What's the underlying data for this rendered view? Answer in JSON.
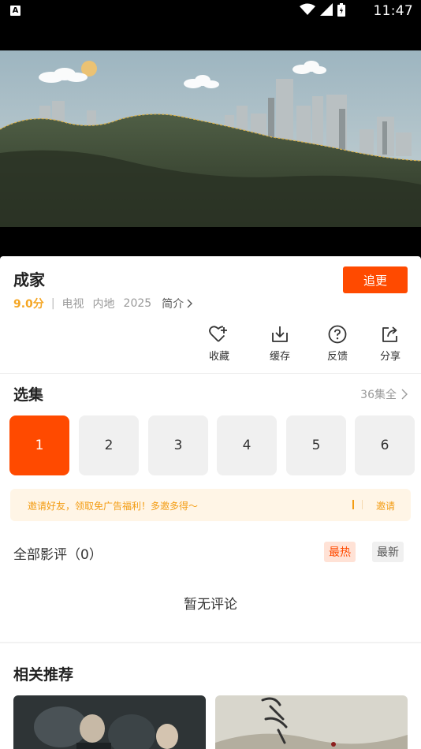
{
  "status_bar": {
    "app_badge": "A",
    "time": "11:47",
    "icons": [
      "wifi-icon",
      "signal-icon",
      "battery-icon"
    ]
  },
  "video": {
    "description_icon": "video-player-frame"
  },
  "drama": {
    "title": "成家",
    "score": "9.0分",
    "type": "电视",
    "region": "内地",
    "year": "2025",
    "intro_label": "简介",
    "follow_label": "追更"
  },
  "actions": [
    {
      "label": "收藏",
      "icon": "heart-plus-icon"
    },
    {
      "label": "缓存",
      "icon": "download-icon"
    },
    {
      "label": "反馈",
      "icon": "question-icon"
    },
    {
      "label": "分享",
      "icon": "share-icon"
    }
  ],
  "episodes": {
    "heading": "选集",
    "count_label": "36集全",
    "items": [
      "1",
      "2",
      "3",
      "4",
      "5",
      "6"
    ],
    "active_index": 0
  },
  "invite": {
    "message": "邀请好友，领取免广告福利！多邀多得～",
    "link_label": "邀请"
  },
  "reviews": {
    "title": "全部影评（0）",
    "sort_hot": "最热",
    "sort_new": "最新",
    "empty_text": "暂无评论"
  },
  "recommendations": {
    "heading": "相关推荐"
  },
  "colors": {
    "accent": "#ff4a00",
    "score": "#f5a623",
    "invite_text": "#f39c12",
    "invite_bg": "#fff5e6"
  }
}
